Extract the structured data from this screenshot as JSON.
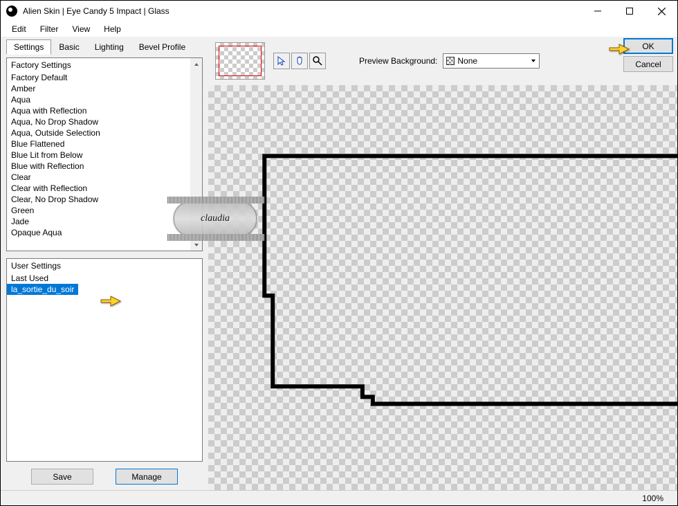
{
  "window": {
    "title": "Alien Skin | Eye Candy 5 Impact | Glass"
  },
  "menu": {
    "edit": "Edit",
    "filter": "Filter",
    "view": "View",
    "help": "Help"
  },
  "tabs": {
    "settings": "Settings",
    "basic": "Basic",
    "lighting": "Lighting",
    "bevel": "Bevel Profile"
  },
  "factory": {
    "header": "Factory Settings",
    "items": [
      "Factory Default",
      "Amber",
      "Aqua",
      "Aqua with Reflection",
      "Aqua, No Drop Shadow",
      "Aqua, Outside Selection",
      "Blue Flattened",
      "Blue Lit from Below",
      "Blue with Reflection",
      "Clear",
      "Clear with Reflection",
      "Clear, No Drop Shadow",
      "Green",
      "Jade",
      "Opaque Aqua"
    ]
  },
  "user": {
    "header": "User Settings",
    "items": [
      "Last Used",
      "la_sortie_du_soir"
    ],
    "selected_index": 1
  },
  "buttons": {
    "save": "Save",
    "manage": "Manage",
    "ok": "OK",
    "cancel": "Cancel"
  },
  "preview": {
    "bg_label": "Preview Background:",
    "bg_value": "None"
  },
  "status": {
    "zoom": "100%"
  },
  "watermark": "claudia"
}
